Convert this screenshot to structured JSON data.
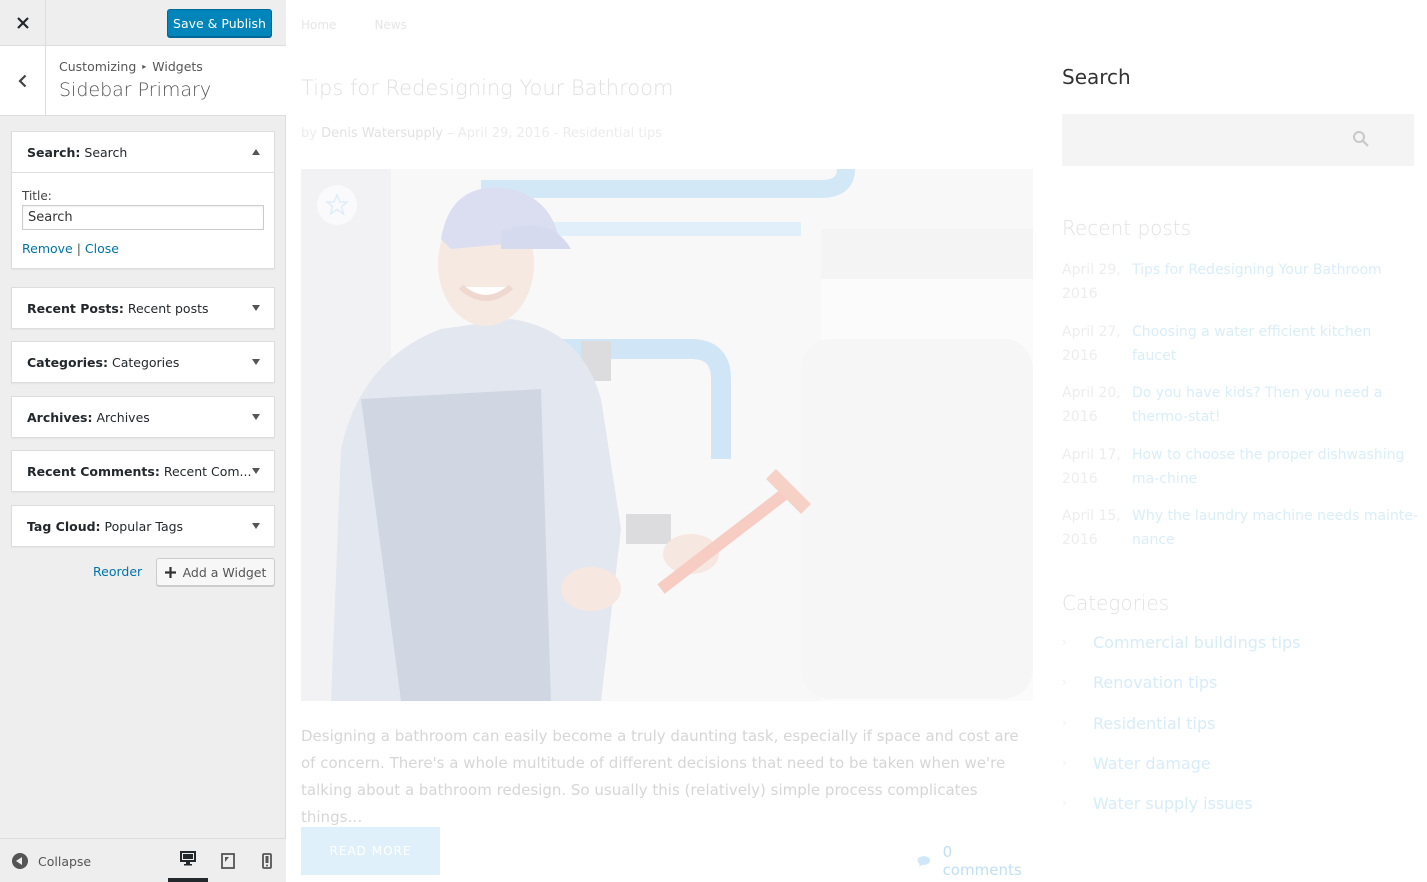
{
  "customizer": {
    "publish_label": "Save & Publish",
    "breadcrumb_parent": "Customizing",
    "breadcrumb_sep": "▸",
    "breadcrumb_current": "Widgets",
    "panel_title": "Sidebar Primary",
    "widgets": [
      {
        "type": "Search:",
        "title": "Search",
        "expanded": true
      },
      {
        "type": "Recent Posts:",
        "title": "Recent posts",
        "expanded": false
      },
      {
        "type": "Categories:",
        "title": "Categories",
        "expanded": false
      },
      {
        "type": "Archives:",
        "title": "Archives",
        "expanded": false
      },
      {
        "type": "Recent Comments:",
        "title": "Recent Com...",
        "expanded": false
      },
      {
        "type": "Tag Cloud:",
        "title": "Popular Tags",
        "expanded": false
      }
    ],
    "search_widget_form": {
      "title_label": "Title:",
      "title_value": "Search",
      "remove_label": "Remove",
      "separator": "|",
      "close_label": "Close"
    },
    "reorder_label": "Reorder",
    "add_widget_label": "Add a Widget",
    "collapse_label": "Collapse",
    "devices": [
      "desktop",
      "tablet",
      "mobile"
    ],
    "active_device": "desktop",
    "accent_color": "#0085ba",
    "link_color": "#0073aa"
  },
  "preview": {
    "nav": [
      "Home",
      "News"
    ],
    "post": {
      "title": "Tips for Redesigning Your Bathroom",
      "meta_by": "by",
      "author": "Denis Watersupply",
      "meta_rest": " – April 29, 2016 - Residential tips",
      "excerpt": "Designing a bathroom can easily become a truly daunting task, especially if space and cost are of concern. There's a whole multitude of different decisions that need to be taken when we're talking about a bathroom redesign. So usually this (relatively) simple process complicates things…",
      "read_more": "READ MORE",
      "comments": "0 comments"
    },
    "sidebar": {
      "search_title": "Search",
      "recent_title": "Recent posts",
      "recent_posts": [
        {
          "date": "April 29, 2016",
          "title": "Tips for Redesigning Your Bathroom"
        },
        {
          "date": "April 27, 2016",
          "title": "Choosing a water efficient kitchen faucet"
        },
        {
          "date": "April 20, 2016",
          "title": "Do you have kids? Then you need a thermo-stat!"
        },
        {
          "date": "April 17, 2016",
          "title": "How to choose the proper dishwashing ma-chine"
        },
        {
          "date": "April 15, 2016",
          "title": "Why the laundry machine needs mainte-nance"
        }
      ],
      "categories_title": "Categories",
      "categories": [
        "Commercial buildings tips",
        "Renovation tips",
        "Residential tips",
        "Water damage",
        "Water supply issues"
      ]
    }
  }
}
